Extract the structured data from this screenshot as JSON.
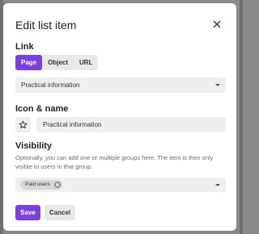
{
  "dialog": {
    "title": "Edit list item"
  },
  "link": {
    "label": "Link",
    "options": [
      "Page",
      "Object",
      "URL"
    ],
    "selected": "Page",
    "page_select_value": "Practical information"
  },
  "icon_name": {
    "label": "Icon & name",
    "icon": "star-icon",
    "name_value": "Practical information"
  },
  "visibility": {
    "label": "Visibility",
    "help": "Optionally, you can add one or multiple groups here. The item is then only visible to users in that group.",
    "chips": [
      "Paid users"
    ]
  },
  "actions": {
    "save_label": "Save",
    "cancel_label": "Cancel"
  },
  "colors": {
    "accent": "#7c3fe0",
    "field_bg": "#efefef",
    "backdrop": "#8a8a8a"
  }
}
